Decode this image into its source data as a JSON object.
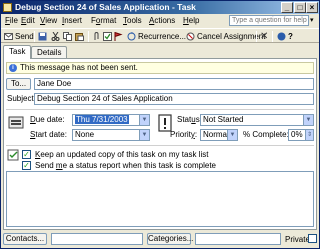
{
  "window": {
    "title": "Debug Section 24 of Sales Application - Task",
    "controls": {
      "minimize": "_",
      "maximize": "□",
      "close": "×"
    }
  },
  "menu": {
    "items": [
      {
        "u": "F",
        "rest": "ile"
      },
      {
        "u": "E",
        "rest": "dit"
      },
      {
        "u": "V",
        "rest": "iew"
      },
      {
        "u": "I",
        "rest": "nsert"
      },
      {
        "pre": "F",
        "u": "o",
        "rest": "rmat"
      },
      {
        "u": "T",
        "rest": "ools"
      },
      {
        "u": "A",
        "rest": "ctions"
      },
      {
        "u": "H",
        "rest": "elp"
      }
    ],
    "help_placeholder": "Type a question for help",
    "help_arrow": "▾"
  },
  "toolbar": {
    "send": "Send",
    "recurrence": "Recurrence...",
    "cancel_assignment": "Cancel Assignment",
    "delete": "✕",
    "help": "?"
  },
  "tabs": [
    "Task",
    "Details"
  ],
  "info_message": "This message has not been sent.",
  "to_button": "To...",
  "to_value": "Jane Doe",
  "subject_label": "Subject:",
  "subject_value": "Debug Section 24 of Sales Application",
  "due_date": {
    "label_u": "D",
    "label_rest": "ue date:",
    "value": "Thu 7/31/2003"
  },
  "start_date": {
    "label_u": "S",
    "label_rest": "tart date:",
    "value": "None"
  },
  "status": {
    "label_pre": "Stat",
    "label_u": "u",
    "label_rest": "s:",
    "value": "Not Started"
  },
  "priority": {
    "label_pre": "Priorit",
    "label_u": "y",
    "label_rest": ":",
    "value": "Normal"
  },
  "complete": {
    "label": "% Complete:",
    "value": "0%"
  },
  "checkbox1": {
    "label_pre": "",
    "label_u": "K",
    "label_rest": "eep an updated copy of this task on my task list",
    "checked": true
  },
  "checkbox2": {
    "label_pre": "Send ",
    "label_u": "m",
    "label_rest": "e a status report when this task is complete",
    "checked": true
  },
  "bottom": {
    "contacts": "Contacts...",
    "categories": "Categories...",
    "private": "Private"
  },
  "colors": {
    "titlebar_start": "#0a246a",
    "selection": "#316ac5",
    "info_bg": "#ffffe1"
  }
}
